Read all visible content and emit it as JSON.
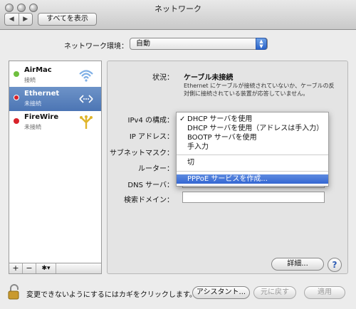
{
  "window": {
    "title": "ネットワーク",
    "show_all": "すべてを表示",
    "back_icon": "◀",
    "forward_icon": "▶"
  },
  "location": {
    "label": "ネットワーク環境：",
    "value": "自動"
  },
  "services": [
    {
      "name": "AirMac",
      "status": "接続",
      "status_color": "#6fbf3f",
      "icon": "wifi-icon"
    },
    {
      "name": "Ethernet",
      "status": "未接続",
      "status_color": "#d8222a",
      "icon": "ethernet-icon"
    },
    {
      "name": "FireWire",
      "status": "未接続",
      "status_color": "#d8222a",
      "icon": "firewire-icon"
    }
  ],
  "sidebar_tools": {
    "add": "+",
    "remove": "−",
    "gear": "✱▾"
  },
  "detail": {
    "status_label": "状況：",
    "status_value": "ケーブル未接続",
    "status_desc_1": "Ethernet にケーブルが接続されていないか、ケーブルの反",
    "status_desc_2": "対側に接続されている装置が応答していません。",
    "ipv4_label": "IPv4 の構成：",
    "ip_label": "IP アドレス：",
    "subnet_label": "サブネットマスク：",
    "router_label": "ルーター：",
    "dns_label": "DNS サーバ：",
    "search_label": "検索ドメイン："
  },
  "ipv4_menu": {
    "checkmark": "✓",
    "items": [
      "DHCP サーバを使用",
      "DHCP サーバを使用（アドレスは手入力）",
      "BOOTP サーバを使用",
      "手入力",
      "切",
      "PPPoE サービスを作成..."
    ],
    "selected_index": 0,
    "highlighted_index": 5
  },
  "buttons": {
    "advanced": "詳細...",
    "help": "?",
    "assistant": "アシスタント...",
    "revert": "元に戻す",
    "apply": "適用"
  },
  "footer": {
    "lock_text": "変更できないようにするにはカギをクリックします。"
  },
  "colors": {
    "selection": "#4c75b4",
    "menu_highlight": "#3467d2"
  }
}
